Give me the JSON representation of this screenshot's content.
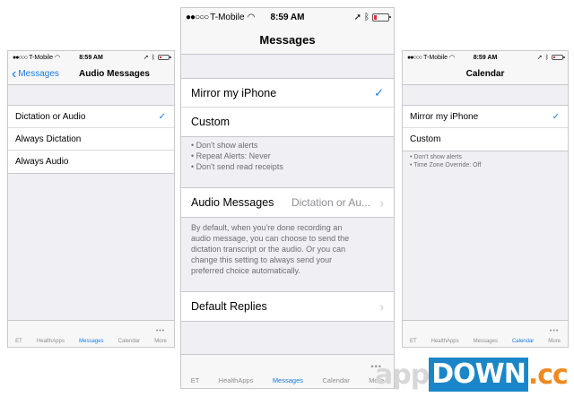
{
  "left": {
    "status": {
      "carrier": "T-Mobile",
      "time": "8:59 AM"
    },
    "nav": {
      "back_label": "Messages",
      "title": "Audio Messages"
    },
    "rows": [
      {
        "label": "Dictation or Audio",
        "checked": true
      },
      {
        "label": "Always Dictation"
      },
      {
        "label": "Always Audio"
      }
    ],
    "tabs": [
      "ET",
      "HealthApps",
      "Messages",
      "Calendar",
      "More"
    ],
    "active_tab": "Messages",
    "more_dots": "•••"
  },
  "center": {
    "status": {
      "carrier": "T-Mobile",
      "time": "8:59 AM"
    },
    "nav": {
      "title": "Messages"
    },
    "alert_rows": [
      {
        "label": "Mirror my iPhone",
        "checked": true
      },
      {
        "label": "Custom"
      }
    ],
    "alert_notes": [
      "• Don't show alerts",
      "• Repeat Alerts: Never",
      "• Don't send read receipts"
    ],
    "audio_row": {
      "label": "Audio Messages",
      "value": "Dictation or Au..."
    },
    "audio_description": [
      "By default, when you're done recording an",
      "audio message, you can choose to send the",
      "dictation transcript or the audio. Or you can",
      "change this setting to always send your",
      "preferred choice automatically."
    ],
    "replies_row": {
      "label": "Default Replies"
    },
    "tabs": [
      "ET",
      "HealthApps",
      "Messages",
      "Calendar",
      "More"
    ],
    "active_tab": "Messages",
    "more_dots": "•••"
  },
  "right": {
    "status": {
      "carrier": "T-Mobile",
      "time": "8:59 AM"
    },
    "nav": {
      "title": "Calendar"
    },
    "rows": [
      {
        "label": "Mirror my iPhone",
        "checked": true
      },
      {
        "label": "Custom"
      }
    ],
    "notes": [
      "• Don't show alerts",
      "• Time Zone Override: Off"
    ],
    "tabs": [
      "ET",
      "HealthApps",
      "Messages",
      "Calendar",
      "More"
    ],
    "active_tab": "Calendar",
    "more_dots": "•••"
  },
  "icons": {
    "signal": "signal-dots-icon",
    "wifi": "wifi-icon",
    "location": "location-arrow-icon",
    "bluetooth": "bluetooth-icon",
    "battery": "battery-icon",
    "check": "checkmark-icon",
    "chevron": "chevron-right-icon",
    "back": "chevron-left-icon"
  },
  "symbols": {
    "signal": "●●○○○",
    "wifi": "◠",
    "location": "➚",
    "bluetooth": "ᛒ",
    "check": "✓",
    "chevron": "›",
    "back": "‹"
  },
  "colors": {
    "accent": "#1a7ae8",
    "background": "#efeff4",
    "secondary_text": "#6d6d72",
    "battery_low": "#e03030"
  },
  "watermark": {
    "part1": "app",
    "part2": "DOWN",
    "part3": ".cc"
  }
}
